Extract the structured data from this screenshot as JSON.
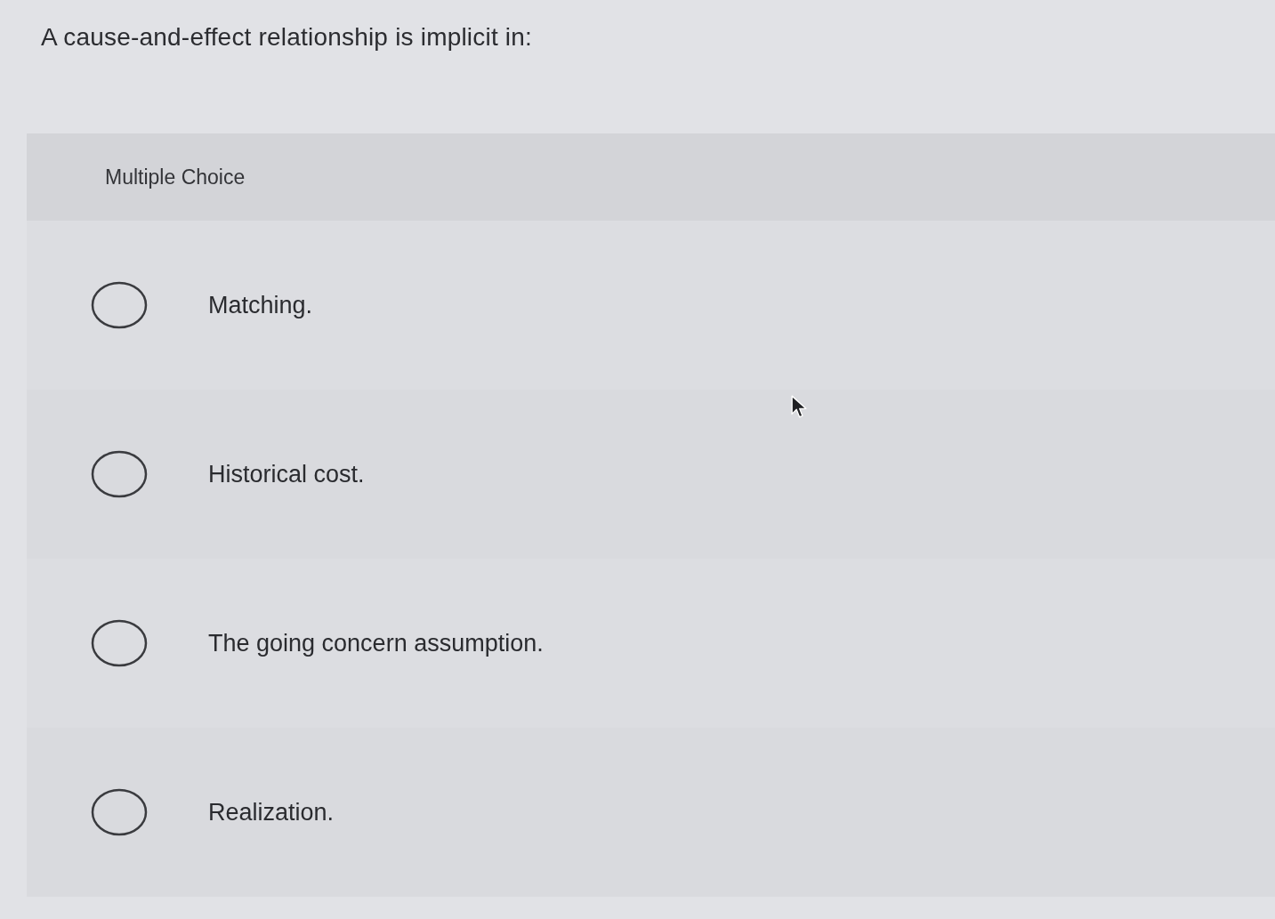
{
  "question": {
    "text": "A cause-and-effect relationship is implicit in:"
  },
  "answer_panel": {
    "type_label": "Multiple Choice",
    "options": [
      {
        "label": "Matching.",
        "selected": false
      },
      {
        "label": "Historical cost.",
        "selected": false
      },
      {
        "label": "The going concern assumption.",
        "selected": false
      },
      {
        "label": "Realization.",
        "selected": false
      }
    ]
  }
}
